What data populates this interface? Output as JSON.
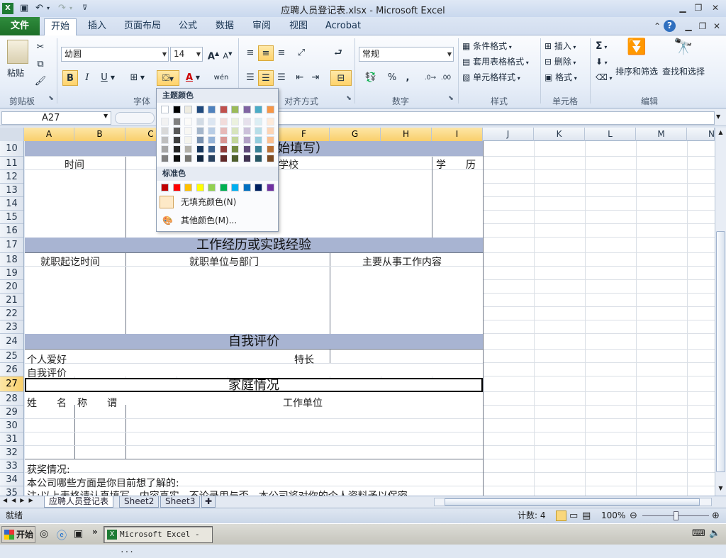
{
  "window": {
    "title": "应聘人员登记表.xlsx - Microsoft Excel"
  },
  "ribbon_tabs": [
    {
      "label": "文件"
    },
    {
      "label": "开始"
    },
    {
      "label": "插入"
    },
    {
      "label": "页面布局"
    },
    {
      "label": "公式"
    },
    {
      "label": "数据"
    },
    {
      "label": "审阅"
    },
    {
      "label": "视图"
    },
    {
      "label": "Acrobat"
    }
  ],
  "ribbon": {
    "clipboard": {
      "paste": "粘贴",
      "group": "剪贴板"
    },
    "font": {
      "name": "幼圆",
      "size": "14",
      "group": "字体",
      "bold": "B",
      "italic": "I",
      "underline": "U",
      "wen": "wén"
    },
    "align": {
      "group": "对齐方式"
    },
    "number": {
      "format": "常规",
      "group": "数字",
      "percent": "%",
      "comma": ","
    },
    "styles": {
      "cond": "条件格式",
      "table": "套用表格格式",
      "cell": "单元格样式",
      "group": "样式"
    },
    "cells": {
      "insert": "插入",
      "delete": "删除",
      "format": "格式",
      "group": "单元格"
    },
    "editing": {
      "sum": "Σ",
      "sort": "排序和筛选",
      "find": "查找和选择",
      "group": "编辑"
    }
  },
  "formula_bar": {
    "name_box": "A27",
    "fx": "fx",
    "value": ""
  },
  "columns": [
    "A",
    "B",
    "C",
    "D",
    "E",
    "F",
    "G",
    "H",
    "I",
    "J",
    "K",
    "L",
    "M",
    "N"
  ],
  "rows": [
    "10",
    "11",
    "12",
    "13",
    "14",
    "15",
    "16",
    "17",
    "18",
    "19",
    "20",
    "21",
    "22",
    "23",
    "24",
    "25",
    "26",
    "27",
    "28",
    "29",
    "30",
    "31",
    "32",
    "33",
    "34",
    "35"
  ],
  "cells": {
    "r10": "开始填写）",
    "r11_a": "时间",
    "r11_f": "学校",
    "r11_i": "学　　历",
    "r17": "工作经历或实践经验",
    "r18_a": "就职起讫时间",
    "r18_c": "就职单位与部门",
    "r18_g": "主要从事工作内容",
    "r24": "自我评价",
    "r25_a": "个人爱好",
    "r25_f": "特长",
    "r26_a": "自我评价",
    "r27": "家庭情况",
    "r28_a": "姓　　名",
    "r28_b": "称　　谓",
    "r28_f": "工作单位",
    "r33": "获奖情况:",
    "r34": "本公司哪些方面是你目前想了解的:",
    "r35": "注:以上表格请认真填写，内容真实，不论录用与否，本公司将对你的个人资料予以保密。"
  },
  "sheet_tabs": [
    {
      "label": "应聘人员登记表"
    },
    {
      "label": "Sheet2"
    },
    {
      "label": "Sheet3"
    }
  ],
  "status": {
    "ready": "就绪",
    "count": "计数: 4",
    "zoom": "100%"
  },
  "color_menu": {
    "theme_title": "主题颜色",
    "standard_title": "标准色",
    "no_fill": "无填充颜色(N)",
    "more": "其他颜色(M)...",
    "theme_colors": [
      "#FFFFFF",
      "#000000",
      "#EEECE1",
      "#1F497D",
      "#4F81BD",
      "#C0504D",
      "#9BBB59",
      "#8064A2",
      "#4BACC6",
      "#F79646"
    ],
    "standard_colors": [
      "#C00000",
      "#FF0000",
      "#FFC000",
      "#FFFF00",
      "#92D050",
      "#00B050",
      "#00B0F0",
      "#0070C0",
      "#002060",
      "#7030A0"
    ]
  },
  "taskbar": {
    "start": "开始",
    "excel_task": "Microsoft Excel - ..."
  }
}
